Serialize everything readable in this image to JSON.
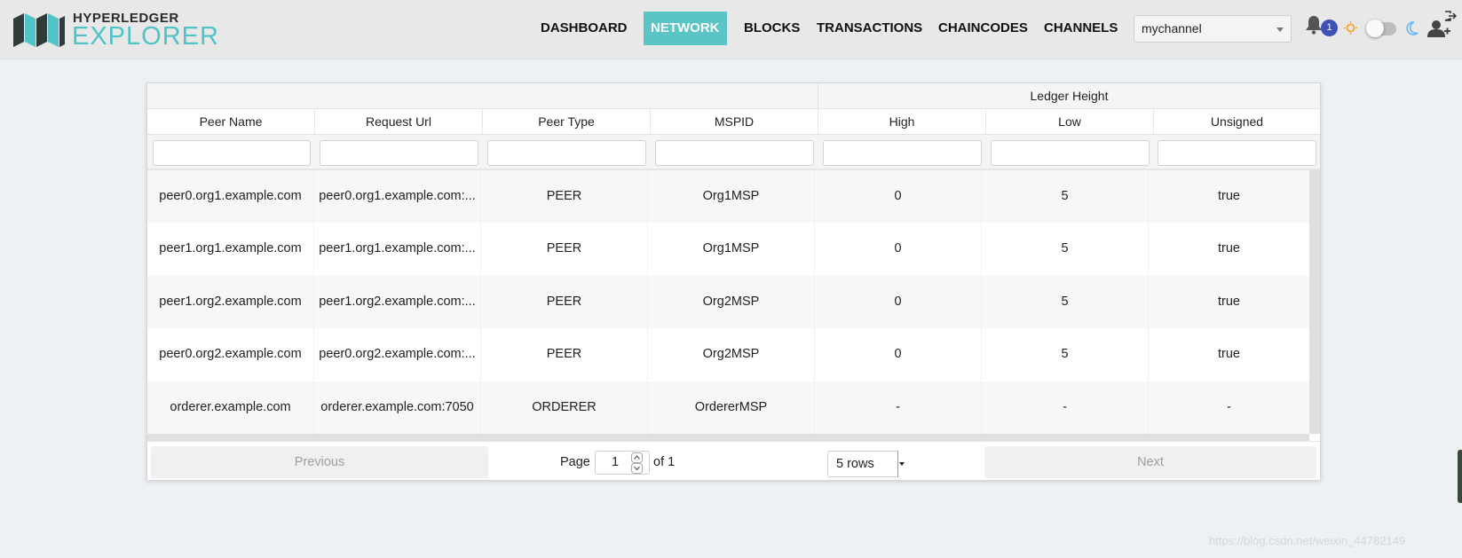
{
  "header": {
    "logo_top": "HYPERLEDGER",
    "logo_bottom": "EXPLORER",
    "nav": [
      "DASHBOARD",
      "NETWORK",
      "BLOCKS",
      "TRANSACTIONS",
      "CHAINCODES",
      "CHANNELS"
    ],
    "active_nav": "NETWORK",
    "channel": "mychannel",
    "notification_count": "1",
    "accent_color": "#5bc4c6",
    "badge_color": "#3f51b5",
    "icons": [
      "bell-icon",
      "sun-icon",
      "theme-toggle",
      "moon-icon",
      "add-user-icon",
      "logout-icon"
    ]
  },
  "table": {
    "group_header": "Ledger Height",
    "columns": [
      "Peer Name",
      "Request Url",
      "Peer Type",
      "MSPID",
      "High",
      "Low",
      "Unsigned"
    ],
    "rows": [
      [
        "peer0.org1.example.com",
        "peer0.org1.example.com:...",
        "PEER",
        "Org1MSP",
        "0",
        "5",
        "true"
      ],
      [
        "peer1.org1.example.com",
        "peer1.org1.example.com:...",
        "PEER",
        "Org1MSP",
        "0",
        "5",
        "true"
      ],
      [
        "peer1.org2.example.com",
        "peer1.org2.example.com:...",
        "PEER",
        "Org2MSP",
        "0",
        "5",
        "true"
      ],
      [
        "peer0.org2.example.com",
        "peer0.org2.example.com:...",
        "PEER",
        "Org2MSP",
        "0",
        "5",
        "true"
      ],
      [
        "orderer.example.com",
        "orderer.example.com:7050",
        "ORDERER",
        "OrdererMSP",
        "-",
        "-",
        "-"
      ]
    ]
  },
  "pagination": {
    "previous_label": "Previous",
    "page_label": "Page",
    "page_value": "1",
    "of_label": "of 1",
    "rows_option": "5 rows",
    "next_label": "Next"
  },
  "watermark": "https://blog.csdn.net/weixin_44782149"
}
